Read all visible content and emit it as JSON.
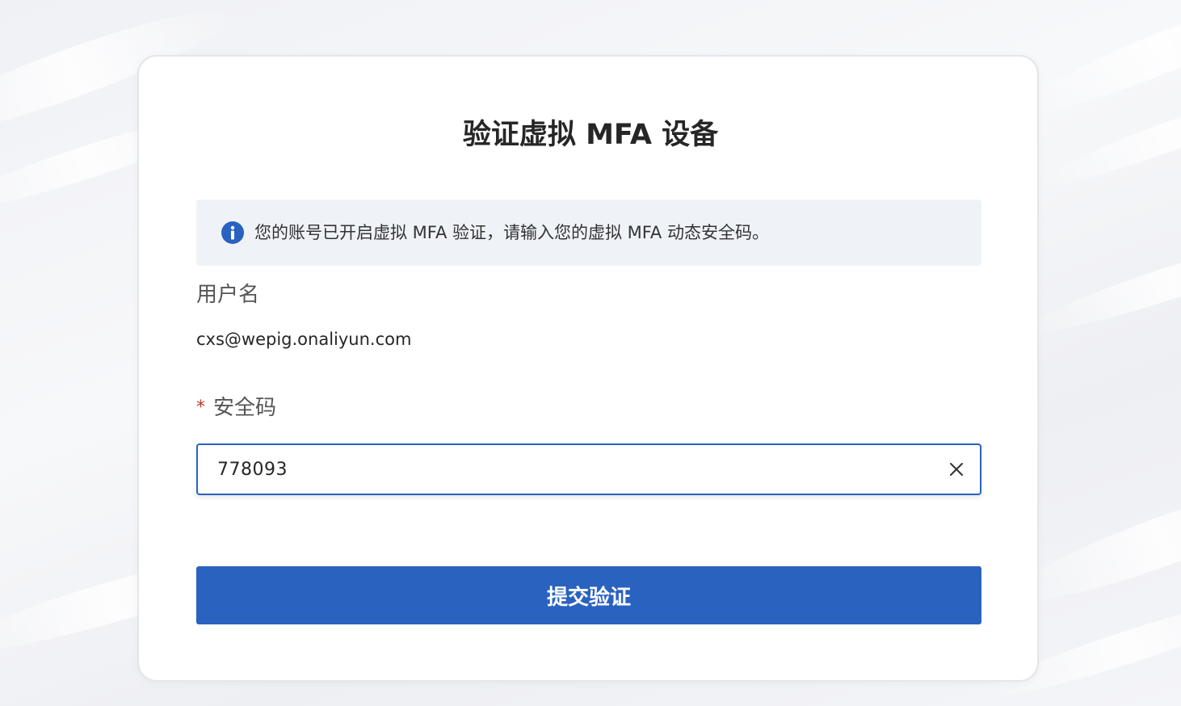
{
  "page": {
    "title": "验证虚拟 MFA 设备"
  },
  "notice": {
    "icon": "info-icon",
    "text": "您的账号已开启虚拟 MFA 验证，请输入您的虚拟 MFA 动态安全码。"
  },
  "form": {
    "username_label": "用户名",
    "username_value": "cxs@wepig.onaliyun.com",
    "code_required_mark": "*",
    "code_label": "安全码",
    "code_value": "778093",
    "clear_icon": "close-icon",
    "submit_label": "提交验证"
  },
  "colors": {
    "accent": "#2a62c0",
    "notice_background": "#eff3f8",
    "required": "#c0392b",
    "info_icon": "#2a62c0"
  }
}
